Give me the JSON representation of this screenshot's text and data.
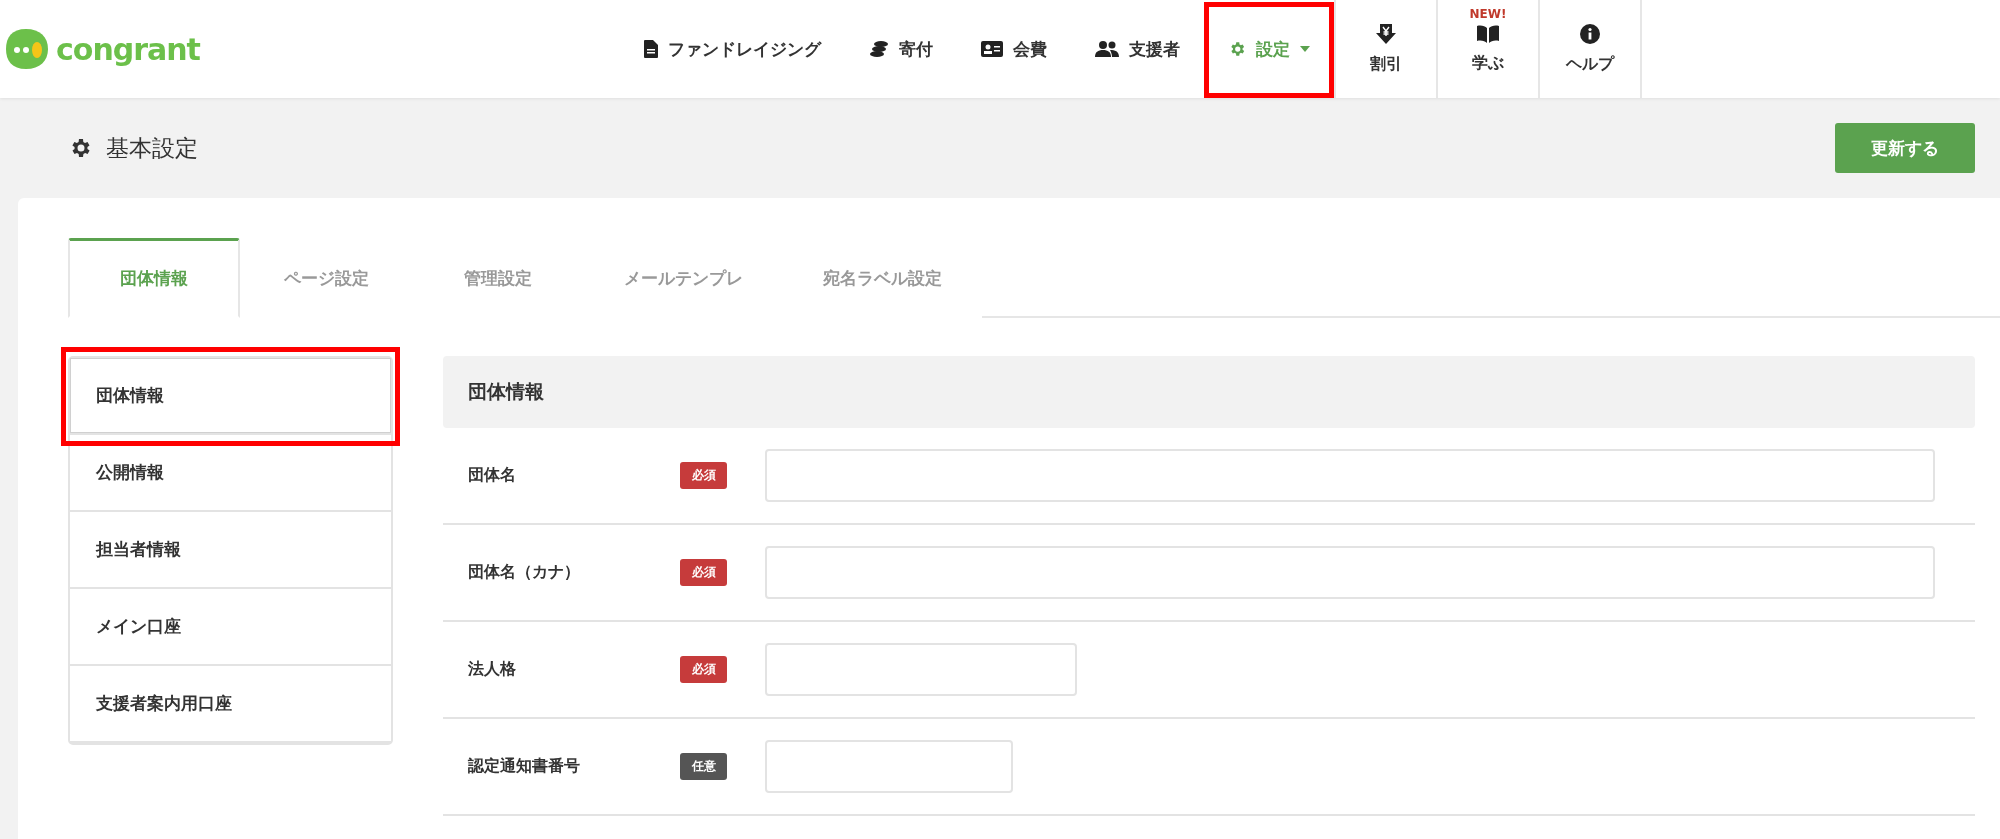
{
  "header": {
    "logo": "congrant",
    "nav": [
      {
        "kind": "doc",
        "label": "ファンドレイジング",
        "selected": false,
        "highlighted": false
      },
      {
        "kind": "coins",
        "label": "寄付",
        "selected": false,
        "highlighted": false
      },
      {
        "kind": "card",
        "label": "会費",
        "selected": false,
        "highlighted": false
      },
      {
        "kind": "users",
        "label": "支援者",
        "selected": false,
        "highlighted": false
      },
      {
        "kind": "gear",
        "label": "設定",
        "selected": true,
        "highlighted": true
      }
    ],
    "tools": [
      {
        "kind": "yen",
        "label": "割引"
      },
      {
        "kind": "book",
        "label": "学ぶ",
        "badge": "NEW!"
      },
      {
        "kind": "info",
        "label": "ヘルプ"
      }
    ]
  },
  "page": {
    "title": "基本設定",
    "update_button": "更新する"
  },
  "tabs": [
    {
      "label": "団体情報",
      "selected": true
    },
    {
      "label": "ページ設定",
      "selected": false
    },
    {
      "label": "管理設定",
      "selected": false
    },
    {
      "label": "メールテンプレ",
      "selected": false
    },
    {
      "label": "宛名ラベル設定",
      "selected": false
    }
  ],
  "sidebar": {
    "items": [
      {
        "label": "団体情報",
        "selected": true,
        "highlighted": true
      },
      {
        "label": "公開情報",
        "selected": false,
        "highlighted": false
      },
      {
        "label": "担当者情報",
        "selected": false,
        "highlighted": false
      },
      {
        "label": "メイン口座",
        "selected": false,
        "highlighted": false
      },
      {
        "label": "支援者案内用口座",
        "selected": false,
        "highlighted": false
      }
    ]
  },
  "section": {
    "title": "団体情報",
    "fields": [
      {
        "label": "団体名",
        "badge": "必須",
        "required": true
      },
      {
        "label": "団体名（カナ）",
        "badge": "必須",
        "required": true
      },
      {
        "label": "法人格",
        "badge": "必須",
        "required": true
      },
      {
        "label": "認定通知書番号",
        "badge": "任意",
        "required": false
      }
    ]
  }
}
